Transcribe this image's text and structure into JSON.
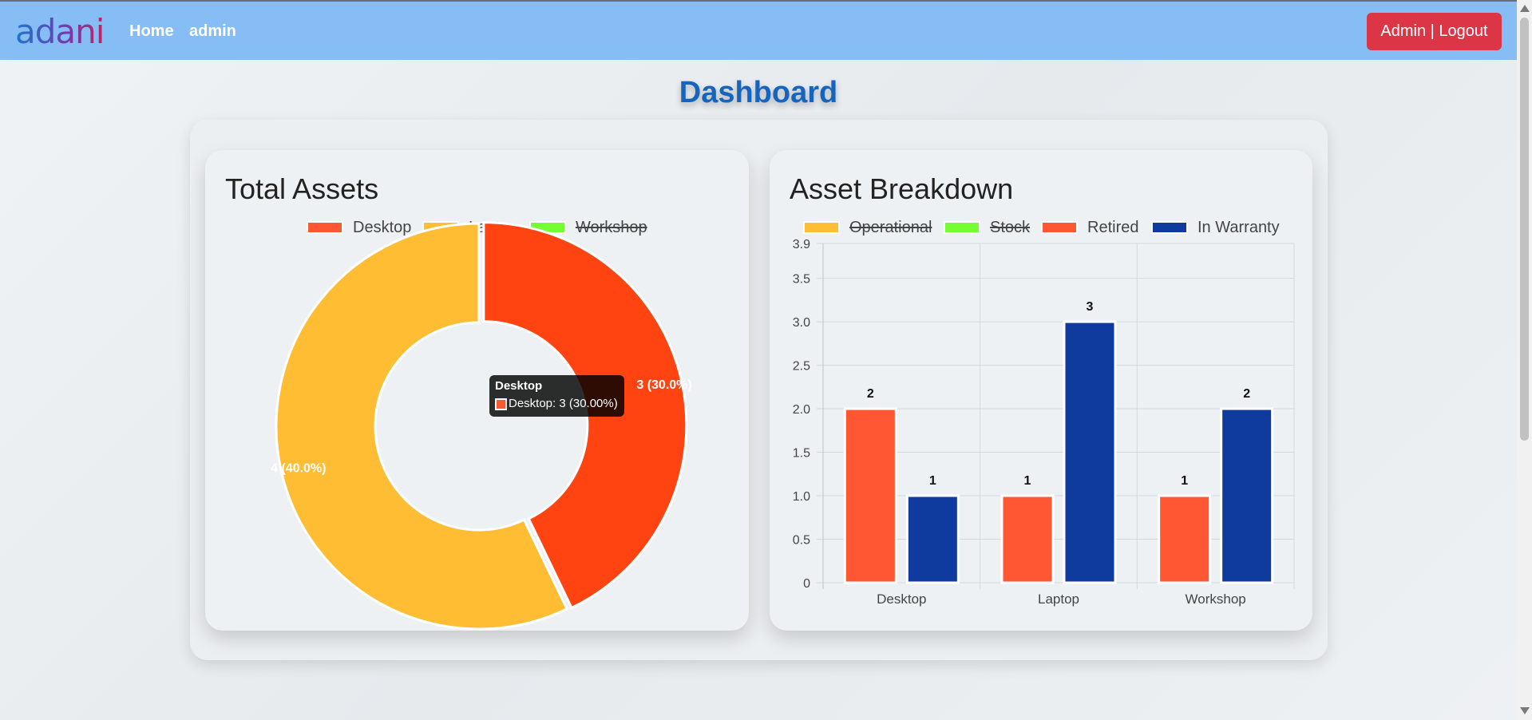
{
  "navbar": {
    "logo_text": "adani",
    "links": [
      "Home",
      "admin"
    ],
    "logout_label": "Admin | Logout",
    "colors": {
      "background": "#86bdf5",
      "logout": "#dc3545"
    }
  },
  "page": {
    "title": "Dashboard"
  },
  "total_assets": {
    "title": "Total Assets",
    "legend": [
      {
        "label": "Desktop",
        "color": "#ff5733",
        "hidden": false
      },
      {
        "label": "Laptop",
        "color": "#ffbd33",
        "hidden": false
      },
      {
        "label": "Workshop",
        "color": "#75ff33",
        "hidden": true
      }
    ],
    "slice_labels": [
      "3 (30.0%)",
      "4 (40.0%)"
    ],
    "tooltip": {
      "title": "Desktop",
      "body": "Desktop: 3 (30.00%)"
    }
  },
  "asset_breakdown": {
    "title": "Asset Breakdown",
    "legend": [
      {
        "label": "Operational",
        "color": "#ffbd33",
        "hidden": true
      },
      {
        "label": "Stock",
        "color": "#75ff33",
        "hidden": true
      },
      {
        "label": "Retired",
        "color": "#ff5733",
        "hidden": false
      },
      {
        "label": "In Warranty",
        "color": "#0f3a9e",
        "hidden": false
      }
    ]
  },
  "chart_data": [
    {
      "type": "pie",
      "title": "Total Assets",
      "categories": [
        "Desktop",
        "Laptop",
        "Workshop"
      ],
      "values": [
        3,
        4,
        3
      ],
      "hidden": [
        "Workshop"
      ],
      "colors": [
        "#ff4412",
        "#ffbd33",
        "#75ff33"
      ],
      "data_labels": [
        "3 (30.0%)",
        "4 (40.0%)"
      ]
    },
    {
      "type": "bar",
      "title": "Asset Breakdown",
      "categories": [
        "Desktop",
        "Laptop",
        "Workshop"
      ],
      "series": [
        {
          "name": "Retired",
          "values": [
            2,
            1,
            1
          ],
          "color": "#ff5733"
        },
        {
          "name": "In Warranty",
          "values": [
            1,
            3,
            2
          ],
          "color": "#0f3a9e"
        }
      ],
      "ylim": [
        0,
        3.9
      ],
      "yticks": [
        "0",
        "0.5",
        "1.0",
        "1.5",
        "2.0",
        "2.5",
        "3.0",
        "3.5",
        "3.9"
      ],
      "grid": true,
      "legend_position": "top"
    }
  ]
}
